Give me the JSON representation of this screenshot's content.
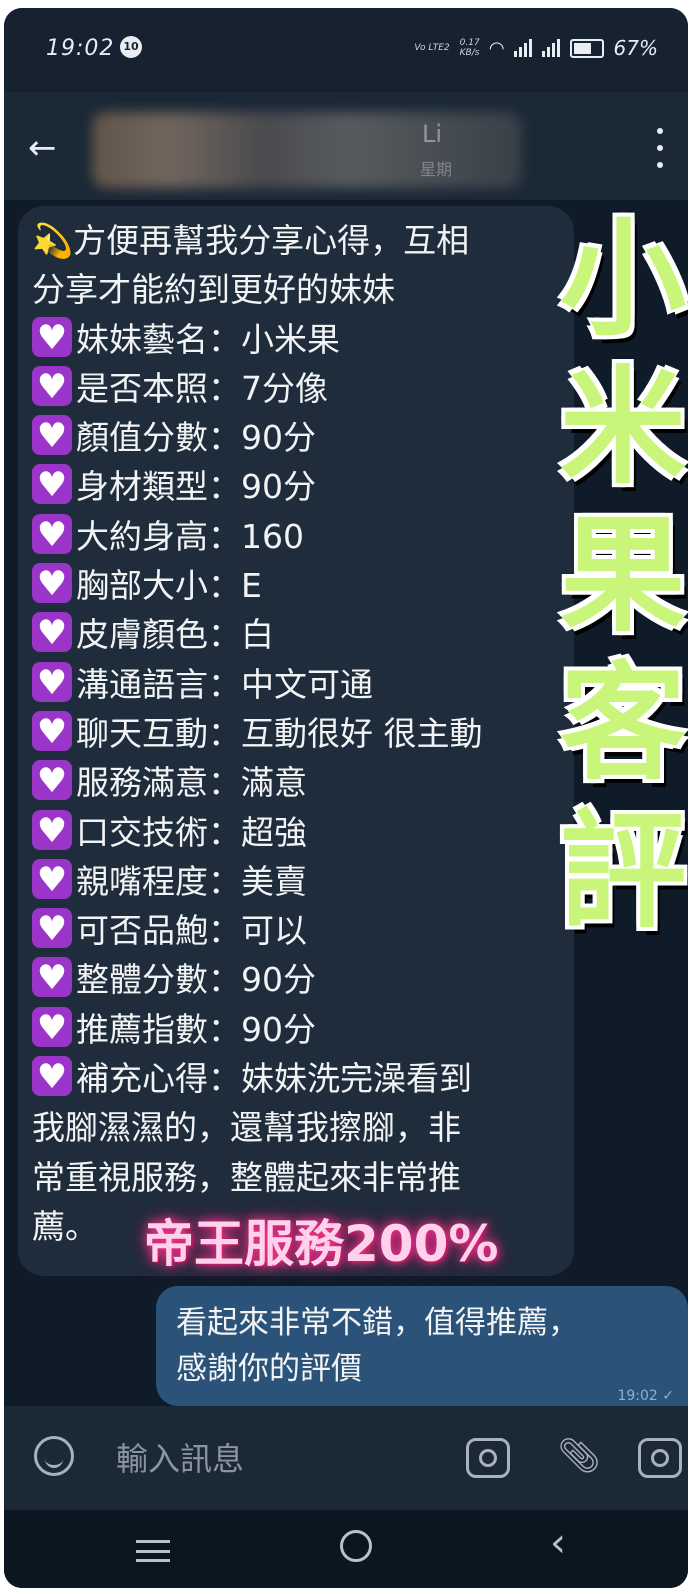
{
  "status_bar": {
    "time": "19:02",
    "badge": "10",
    "net_top": "0.17",
    "net_bottom": "KB/s",
    "volte": "Vo LTE2",
    "battery": "67%"
  },
  "header": {
    "back_icon": "arrow-left-icon",
    "contact_name": "Li",
    "contact_status": "星期"
  },
  "incoming_message": {
    "lines": [
      {
        "icon": "",
        "text": "💫方便再幫我分享心得，互相"
      },
      {
        "icon": "",
        "text": "分享才能約到更好的妹妹"
      },
      {
        "icon": "heart",
        "text": "妹妹藝名：小米果"
      },
      {
        "icon": "heart",
        "text": "是否本照：7分像"
      },
      {
        "icon": "heart",
        "text": "顏值分數：90分"
      },
      {
        "icon": "heart",
        "text": "身材類型：90分"
      },
      {
        "icon": "heart",
        "text": "大約身高：160"
      },
      {
        "icon": "heart",
        "text": "胸部大小：E"
      },
      {
        "icon": "heart",
        "text": "皮膚顏色：白"
      },
      {
        "icon": "heart",
        "text": "溝通語言：中文可通"
      },
      {
        "icon": "heart",
        "text": "聊天互動：互動很好 很主動"
      },
      {
        "icon": "heart",
        "text": "服務滿意：滿意"
      },
      {
        "icon": "heart",
        "text": "口交技術：超強"
      },
      {
        "icon": "heart",
        "text": "親嘴程度：美賣"
      },
      {
        "icon": "heart",
        "text": "可否品鮑：可以"
      },
      {
        "icon": "heart",
        "text": "整體分數：90分"
      },
      {
        "icon": "heart",
        "text": "推薦指數：90分"
      },
      {
        "icon": "heart",
        "text": "補充心得：妹妹洗完澡看到"
      },
      {
        "icon": "",
        "text": "我腳濕濕的，還幫我擦腳，非"
      },
      {
        "icon": "",
        "text": "常重視服務，整體起來非常推"
      },
      {
        "icon": "",
        "text": "薦。"
      }
    ]
  },
  "overlay": {
    "vertical_title": [
      "小",
      "米",
      "果",
      "客",
      "評"
    ],
    "pink_caption": "帝王服務200%"
  },
  "outgoing_message": {
    "line1": "看起來非常不錯，值得推薦，",
    "line2": "感謝你的評價",
    "time": "19:02 ✓"
  },
  "input_bar": {
    "placeholder": "輸入訊息"
  },
  "colors": {
    "background": "#0f1b29",
    "incoming_bubble": "#1f2c3b",
    "outgoing_bubble": "#2b5278",
    "heart_box": "#9b34c9",
    "title_green": "#c8f57a",
    "caption_pink": "#ff3d9a"
  }
}
